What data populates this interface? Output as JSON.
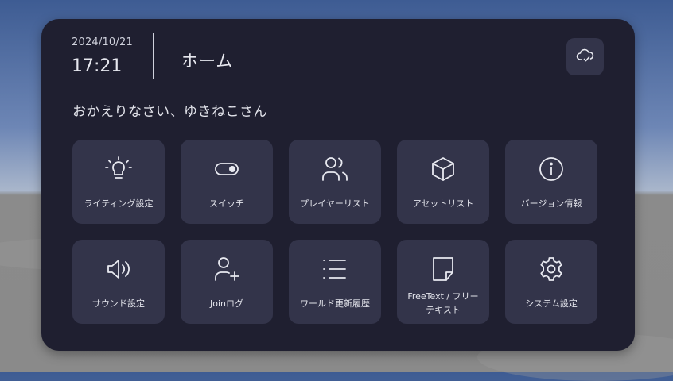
{
  "header": {
    "date": "2024/10/21",
    "time": "17:21",
    "title": "ホーム",
    "cloud_icon": "cloud-sync-icon"
  },
  "welcome": "おかえりなさい、ゆきねこさん",
  "colors": {
    "panel_bg": "#1f1f30",
    "tile_bg": "#33344a",
    "text": "#e6e7ee"
  },
  "tiles": [
    {
      "label": "ライティング設定",
      "icon": "lightbulb-icon"
    },
    {
      "label": "スイッチ",
      "icon": "toggle-icon"
    },
    {
      "label": "プレイヤーリスト",
      "icon": "users-icon"
    },
    {
      "label": "アセットリスト",
      "icon": "cube-icon"
    },
    {
      "label": "バージョン情報",
      "icon": "info-icon"
    },
    {
      "label": "サウンド設定",
      "icon": "speaker-icon"
    },
    {
      "label": "Joinログ",
      "icon": "user-add-icon"
    },
    {
      "label": "ワールド更新履歴",
      "icon": "list-icon"
    },
    {
      "label": "FreeText / フリーテキスト",
      "icon": "sticky-note-icon"
    },
    {
      "label": "システム設定",
      "icon": "gear-icon"
    }
  ]
}
